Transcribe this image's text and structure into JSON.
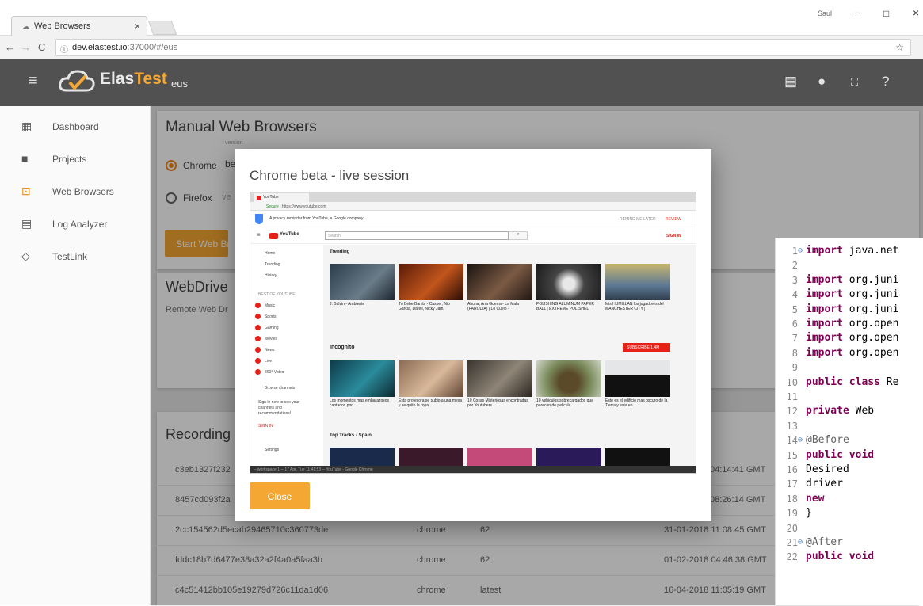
{
  "browser": {
    "tab_title": "Web Browsers",
    "tab_close": "×",
    "window_user": "Saul",
    "window_minimize": "−",
    "window_maximize": "□",
    "window_close": "×",
    "url_host": "dev.elastest.io",
    "url_path": ":37000/#/eus"
  },
  "app": {
    "brand_main": "Elas",
    "brand_accent": "Test",
    "section": "eus",
    "accent_color": "#f4a733"
  },
  "sidebar": {
    "items": [
      {
        "label": "Dashboard",
        "icon": "dashboard-icon"
      },
      {
        "label": "Projects",
        "icon": "folder-icon"
      },
      {
        "label": "Web Browsers",
        "icon": "web-browsers-icon"
      },
      {
        "label": "Log Analyzer",
        "icon": "log-icon"
      },
      {
        "label": "TestLink",
        "icon": "testlink-icon"
      }
    ]
  },
  "manual": {
    "title": "Manual Web Browsers",
    "version_label": "version",
    "chrome_label": "Chrome",
    "chrome_version": "be",
    "firefox_label": "Firefox",
    "firefox_version": "ve",
    "start_button": "Start Web Bro"
  },
  "webdriver": {
    "title": "WebDrive",
    "subtitle": "Remote Web Dr"
  },
  "recordings": {
    "title": "Recording",
    "rows": [
      {
        "id": "c3eb1327f232",
        "browser": "",
        "version": "",
        "date": "04:14:41 GMT"
      },
      {
        "id": "8457cd093f2a",
        "browser": "",
        "version": "",
        "date": "08:26:14 GMT"
      },
      {
        "id": "2cc154562d5ecab29465710c360773de",
        "browser": "chrome",
        "version": "62",
        "date": "31-01-2018 11:08:45 GMT"
      },
      {
        "id": "fddc18b7d6477e38a32a2f4a0a5faa3b",
        "browser": "chrome",
        "version": "62",
        "date": "01-02-2018 04:46:38 GMT"
      },
      {
        "id": "c4c51412bb105e19279d726c11da1d06",
        "browser": "chrome",
        "version": "latest",
        "date": "16-04-2018 11:05:19 GMT"
      }
    ]
  },
  "modal": {
    "title": "Chrome beta - live session",
    "close_button": "Close"
  },
  "youtube": {
    "tab_title": "YouTube",
    "secure": "Secure",
    "url": "https://www.youtube.com",
    "notice": "A privacy reminder from YouTube, a Google company",
    "remind_later": "REMIND ME LATER",
    "review": "REVIEW",
    "logo": "YouTube",
    "search_placeholder": "Search",
    "sign_in": "SIGN IN",
    "nav": [
      "Home",
      "Trending",
      "History"
    ],
    "best_of": "BEST OF YOUTUBE",
    "channels": [
      "Music",
      "Sports",
      "Gaming",
      "Movies",
      "News",
      "Live",
      "360° Video"
    ],
    "browse": "Browse channels",
    "signin_note": "Sign in now to see your channels and recommendations!",
    "signin_link": "SIGN IN",
    "settings": "Settings",
    "trending": "Trending",
    "incognito": "Incognito",
    "subscribe": "SUBSCRIBE 1.4M",
    "top_tracks": "Top Tracks - Spain",
    "trending_titles": [
      "J. Balvin - Ambiente",
      "Tu Bebe Bambi - Casper, Nio Garcia, Darell, Nicky Jam,",
      "Abuna, Ana Guerra - La Mala (PARODIA) | Lo Cuelo -",
      "POLISHING ALUMINUM PAPER BALL | EXTREME POLISHED",
      "Mis HUMILLAN los jugadores del MANCHESTER CITY |"
    ],
    "incognito_titles": [
      "Los momentos mas embarazosos captados por",
      "Esta profesora se subio a una mesa y se quito la ropa,",
      "10 Cosas Misteriosas encontradas por Youtubers",
      "10 vehiculos sobrecargados que parecen de pelicula",
      "Este es el edificio mas oscuro de la Tierra y esta en"
    ],
    "status": "─ workspace 1 ─ 17 Apr, Tue 11:41:53 ─ YouTube - Google Chrome"
  },
  "code": {
    "lines": [
      {
        "n": "1",
        "fold": true,
        "parts": [
          [
            "kw",
            "import"
          ],
          [
            "",
            "java.net"
          ]
        ]
      },
      {
        "n": "2",
        "parts": []
      },
      {
        "n": "3",
        "parts": [
          [
            "kw",
            "import"
          ],
          [
            "",
            "org.juni"
          ]
        ]
      },
      {
        "n": "4",
        "parts": [
          [
            "kw",
            "import"
          ],
          [
            "",
            "org.juni"
          ]
        ]
      },
      {
        "n": "5",
        "parts": [
          [
            "kw",
            "import"
          ],
          [
            "",
            "org.juni"
          ]
        ]
      },
      {
        "n": "6",
        "parts": [
          [
            "kw",
            "import"
          ],
          [
            "",
            "org.open"
          ]
        ]
      },
      {
        "n": "7",
        "parts": [
          [
            "kw",
            "import"
          ],
          [
            "",
            "org.open"
          ]
        ]
      },
      {
        "n": "8",
        "parts": [
          [
            "kw",
            "import"
          ],
          [
            "",
            "org.open"
          ]
        ]
      },
      {
        "n": "9",
        "parts": []
      },
      {
        "n": "10",
        "parts": [
          [
            "kw",
            "public class"
          ],
          [
            "",
            "Re"
          ]
        ]
      },
      {
        "n": "11",
        "parts": []
      },
      {
        "n": "12",
        "parts": [
          [
            "",
            "    "
          ],
          [
            "kw",
            "private"
          ],
          [
            "",
            "Web"
          ]
        ]
      },
      {
        "n": "13",
        "parts": []
      },
      {
        "n": "14",
        "fold": true,
        "parts": [
          [
            "",
            "    "
          ],
          [
            "ann",
            "@Before"
          ]
        ]
      },
      {
        "n": "15",
        "parts": [
          [
            "",
            "    "
          ],
          [
            "kw",
            "public void"
          ]
        ]
      },
      {
        "n": "16",
        "parts": [
          [
            "",
            "        Desired"
          ]
        ]
      },
      {
        "n": "17",
        "parts": [
          [
            "",
            "        driver"
          ]
        ]
      },
      {
        "n": "18",
        "parts": [
          [
            "",
            "            "
          ],
          [
            "kw",
            "new"
          ]
        ]
      },
      {
        "n": "19",
        "parts": [
          [
            "",
            "    }"
          ]
        ]
      },
      {
        "n": "20",
        "parts": []
      },
      {
        "n": "21",
        "fold": true,
        "parts": [
          [
            "",
            "    "
          ],
          [
            "ann",
            "@After"
          ]
        ]
      },
      {
        "n": "22",
        "parts": [
          [
            "",
            "    "
          ],
          [
            "kw",
            "public void"
          ]
        ]
      }
    ]
  }
}
